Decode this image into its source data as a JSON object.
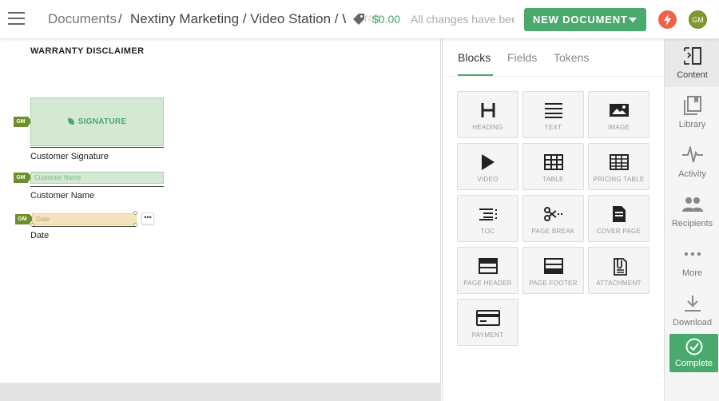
{
  "header": {
    "breadcrumb_root": "Documents",
    "breadcrumb_sep": "/",
    "breadcrumb_path": "Nextiny Marketing / Video Station / W",
    "draft_fragment": "raft",
    "price": "$0.00",
    "save_status": "All changes have been",
    "new_document_label": "NEW DOCUMENT",
    "avatar_initials": "GM"
  },
  "document": {
    "section_title": "WARRANTY DISCLAIMER",
    "signature_label": "SIGNATURE",
    "signature_caption": "Customer Signature",
    "name_placeholder": "Customer Name",
    "name_caption": "Customer Name",
    "date_placeholder": "Date",
    "date_caption": "Date",
    "assignee_tag": "GM",
    "more_label": "•••"
  },
  "panel": {
    "tabs": [
      "Blocks",
      "Fields",
      "Tokens"
    ],
    "active_tab": "Blocks",
    "blocks": [
      {
        "label": "HEADING",
        "icon": "heading-icon"
      },
      {
        "label": "TEXT",
        "icon": "text-icon"
      },
      {
        "label": "IMAGE",
        "icon": "image-icon"
      },
      {
        "label": "VIDEO",
        "icon": "video-icon"
      },
      {
        "label": "TABLE",
        "icon": "table-icon"
      },
      {
        "label": "PRICING TABLE",
        "icon": "pricing-table-icon"
      },
      {
        "label": "TOC",
        "icon": "toc-icon"
      },
      {
        "label": "PAGE BREAK",
        "icon": "page-break-icon"
      },
      {
        "label": "COVER PAGE",
        "icon": "cover-page-icon"
      },
      {
        "label": "PAGE HEADER",
        "icon": "page-header-icon"
      },
      {
        "label": "PAGE FOOTER",
        "icon": "page-footer-icon"
      },
      {
        "label": "ATTACHMENT",
        "icon": "attachment-icon"
      },
      {
        "label": "PAYMENT",
        "icon": "payment-icon"
      }
    ]
  },
  "rail": {
    "items": [
      {
        "label": "Content",
        "icon": "content-icon"
      },
      {
        "label": "Library",
        "icon": "library-icon"
      },
      {
        "label": "Activity",
        "icon": "activity-icon"
      },
      {
        "label": "Recipients",
        "icon": "recipients-icon"
      },
      {
        "label": "More",
        "icon": "more-icon"
      },
      {
        "label": "Download",
        "icon": "download-icon"
      }
    ],
    "complete_label": "Complete"
  },
  "colors": {
    "accent": "#4aa96c",
    "bolt": "#f0604a",
    "avatar": "#7f9a2b"
  }
}
